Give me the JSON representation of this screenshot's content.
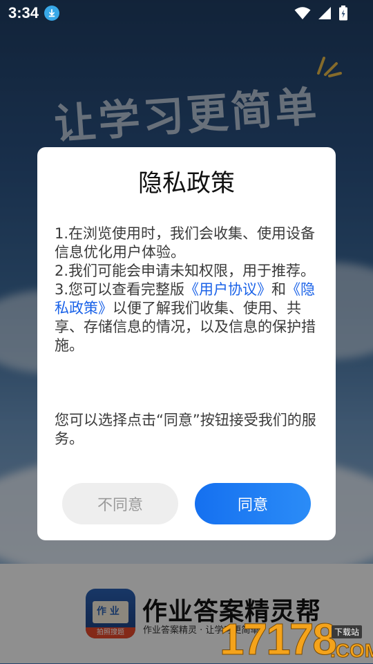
{
  "status_bar": {
    "time": "3:34",
    "icons": [
      "download-icon",
      "wifi-icon",
      "cell-signal-icon",
      "battery-charging-icon"
    ]
  },
  "background": {
    "slogan": "让学习更简单"
  },
  "dialog": {
    "title": "隐私政策",
    "items": [
      {
        "text": "1.在浏览使用时，我们会收集、使用设备信息优化用户体验。"
      },
      {
        "text": "2.我们可能会申请未知权限，用于推荐。"
      },
      {
        "prefix": "3.您可以查看完整版",
        "link_user_agreement": "《用户协议》",
        "and": "和",
        "link_privacy_policy": "《隐私政策》",
        "suffix": "以便了解我们收集、使用、共享、存储信息的情况，以及信息的保护措施。"
      }
    ],
    "footer_text": "您可以选择点击“同意”按钮接受我们的服务。",
    "disagree_label": "不同意",
    "agree_label": "同意"
  },
  "bottom": {
    "app_name": "作业答案精灵帮",
    "tagline": "作业答案精灵 · 让学习更简单",
    "logo_text": "作 业",
    "logo_ribbon": "拍照搜题",
    "watermark_number": "17178",
    "watermark_tag": "下载站",
    "watermark_domain": ".COM"
  },
  "colors": {
    "accent": "#1a62e8",
    "agree_button": "#1570f0",
    "disagree_button_bg": "#eeeeee",
    "watermark": "#f4a31b"
  }
}
